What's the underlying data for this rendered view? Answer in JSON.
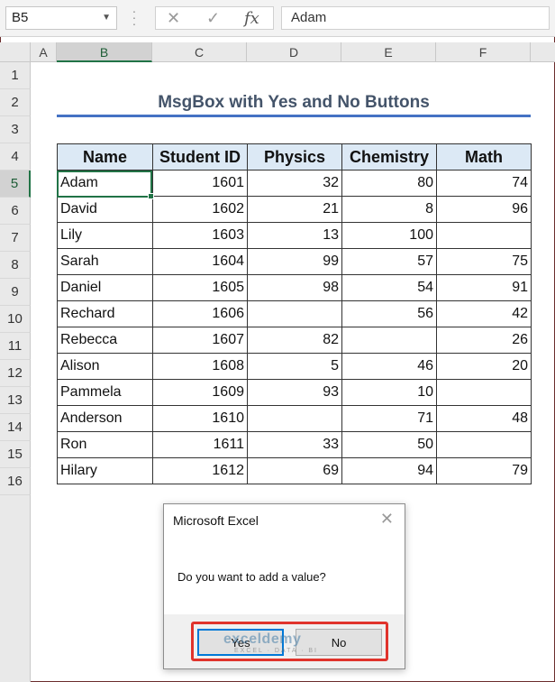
{
  "formula_bar": {
    "name_box": "B5",
    "name_box_dropdown_icon": "chevron-down-icon",
    "cancel_icon": "✕",
    "enter_icon": "✓",
    "function_icon": "fx",
    "formula": "Adam"
  },
  "columns": [
    "A",
    "B",
    "C",
    "D",
    "E",
    "F"
  ],
  "selected_column": "B",
  "rows": [
    "1",
    "2",
    "3",
    "4",
    "5",
    "6",
    "7",
    "8",
    "9",
    "10",
    "11",
    "12",
    "13",
    "14",
    "15",
    "16"
  ],
  "selected_row": "5",
  "sheet": {
    "title": "MsgBox with Yes and No Buttons",
    "headers": [
      "Name",
      "Student ID",
      "Physics",
      "Chemistry",
      "Math"
    ],
    "records": [
      [
        "Adam",
        "1601",
        "32",
        "80",
        "74"
      ],
      [
        "David",
        "1602",
        "21",
        "8",
        "96"
      ],
      [
        "Lily",
        "1603",
        "13",
        "100",
        ""
      ],
      [
        "Sarah",
        "1604",
        "99",
        "57",
        "75"
      ],
      [
        "Daniel",
        "1605",
        "98",
        "54",
        "91"
      ],
      [
        "Rechard",
        "1606",
        "",
        "56",
        "42"
      ],
      [
        "Rebecca",
        "1607",
        "82",
        "",
        "26"
      ],
      [
        "Alison",
        "1608",
        "5",
        "46",
        "20"
      ],
      [
        "Pammela",
        "1609",
        "93",
        "10",
        ""
      ],
      [
        "Anderson",
        "1610",
        "",
        "71",
        "48"
      ],
      [
        "Ron",
        "1611",
        "33",
        "50",
        ""
      ],
      [
        "Hilary",
        "1612",
        "69",
        "94",
        "79"
      ]
    ]
  },
  "dialog": {
    "title": "Microsoft Excel",
    "close_icon": "✕",
    "message": "Do you want to add a value?",
    "yes_label": "Yes",
    "no_label": "No",
    "highlight_color": "#e0332c"
  },
  "watermark": {
    "name": "exceldemy",
    "tagline": "EXCEL · DATA · BI"
  },
  "colors": {
    "accent": "#217346",
    "header_fill": "#dce9f5",
    "title_text": "#44546a",
    "title_underline": "#4472c4"
  }
}
